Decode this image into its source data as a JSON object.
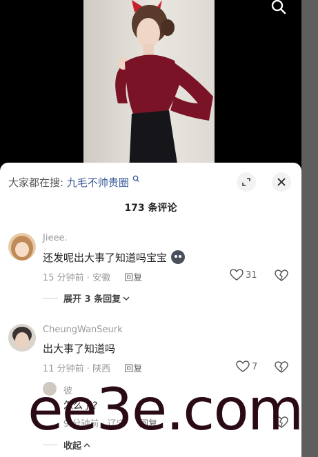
{
  "colors": {
    "accent_link": "#3a5a9a",
    "watermark": "#2b0a17",
    "sheet_bg": "#ffffff"
  },
  "video": {
    "description_icon": "search-icon"
  },
  "hot_search": {
    "prefix": "大家都在搜:",
    "keyword": "九毛不帅贵圈"
  },
  "comments_header": {
    "count_label": "173 条评论"
  },
  "comments": [
    {
      "user": "Jieee.",
      "text": "还发呢出大事了知道吗宝宝",
      "meta": "15 分钟前 · 安徽",
      "reply_label": "回复",
      "likes": "31",
      "expand_label": "展开 3 条回复"
    },
    {
      "user": "CheungWanSeurk",
      "text": "出大事了知道吗",
      "meta": "11 分钟前 · 陕西",
      "reply_label": "回复",
      "likes": "7",
      "subreply": {
        "user": "彼",
        "text": "怎么了?",
        "meta": "9 分钟前 · 辽宁",
        "reply_label": "回复"
      },
      "collapse_label": "收起"
    }
  ],
  "watermark": "ee3e.com"
}
